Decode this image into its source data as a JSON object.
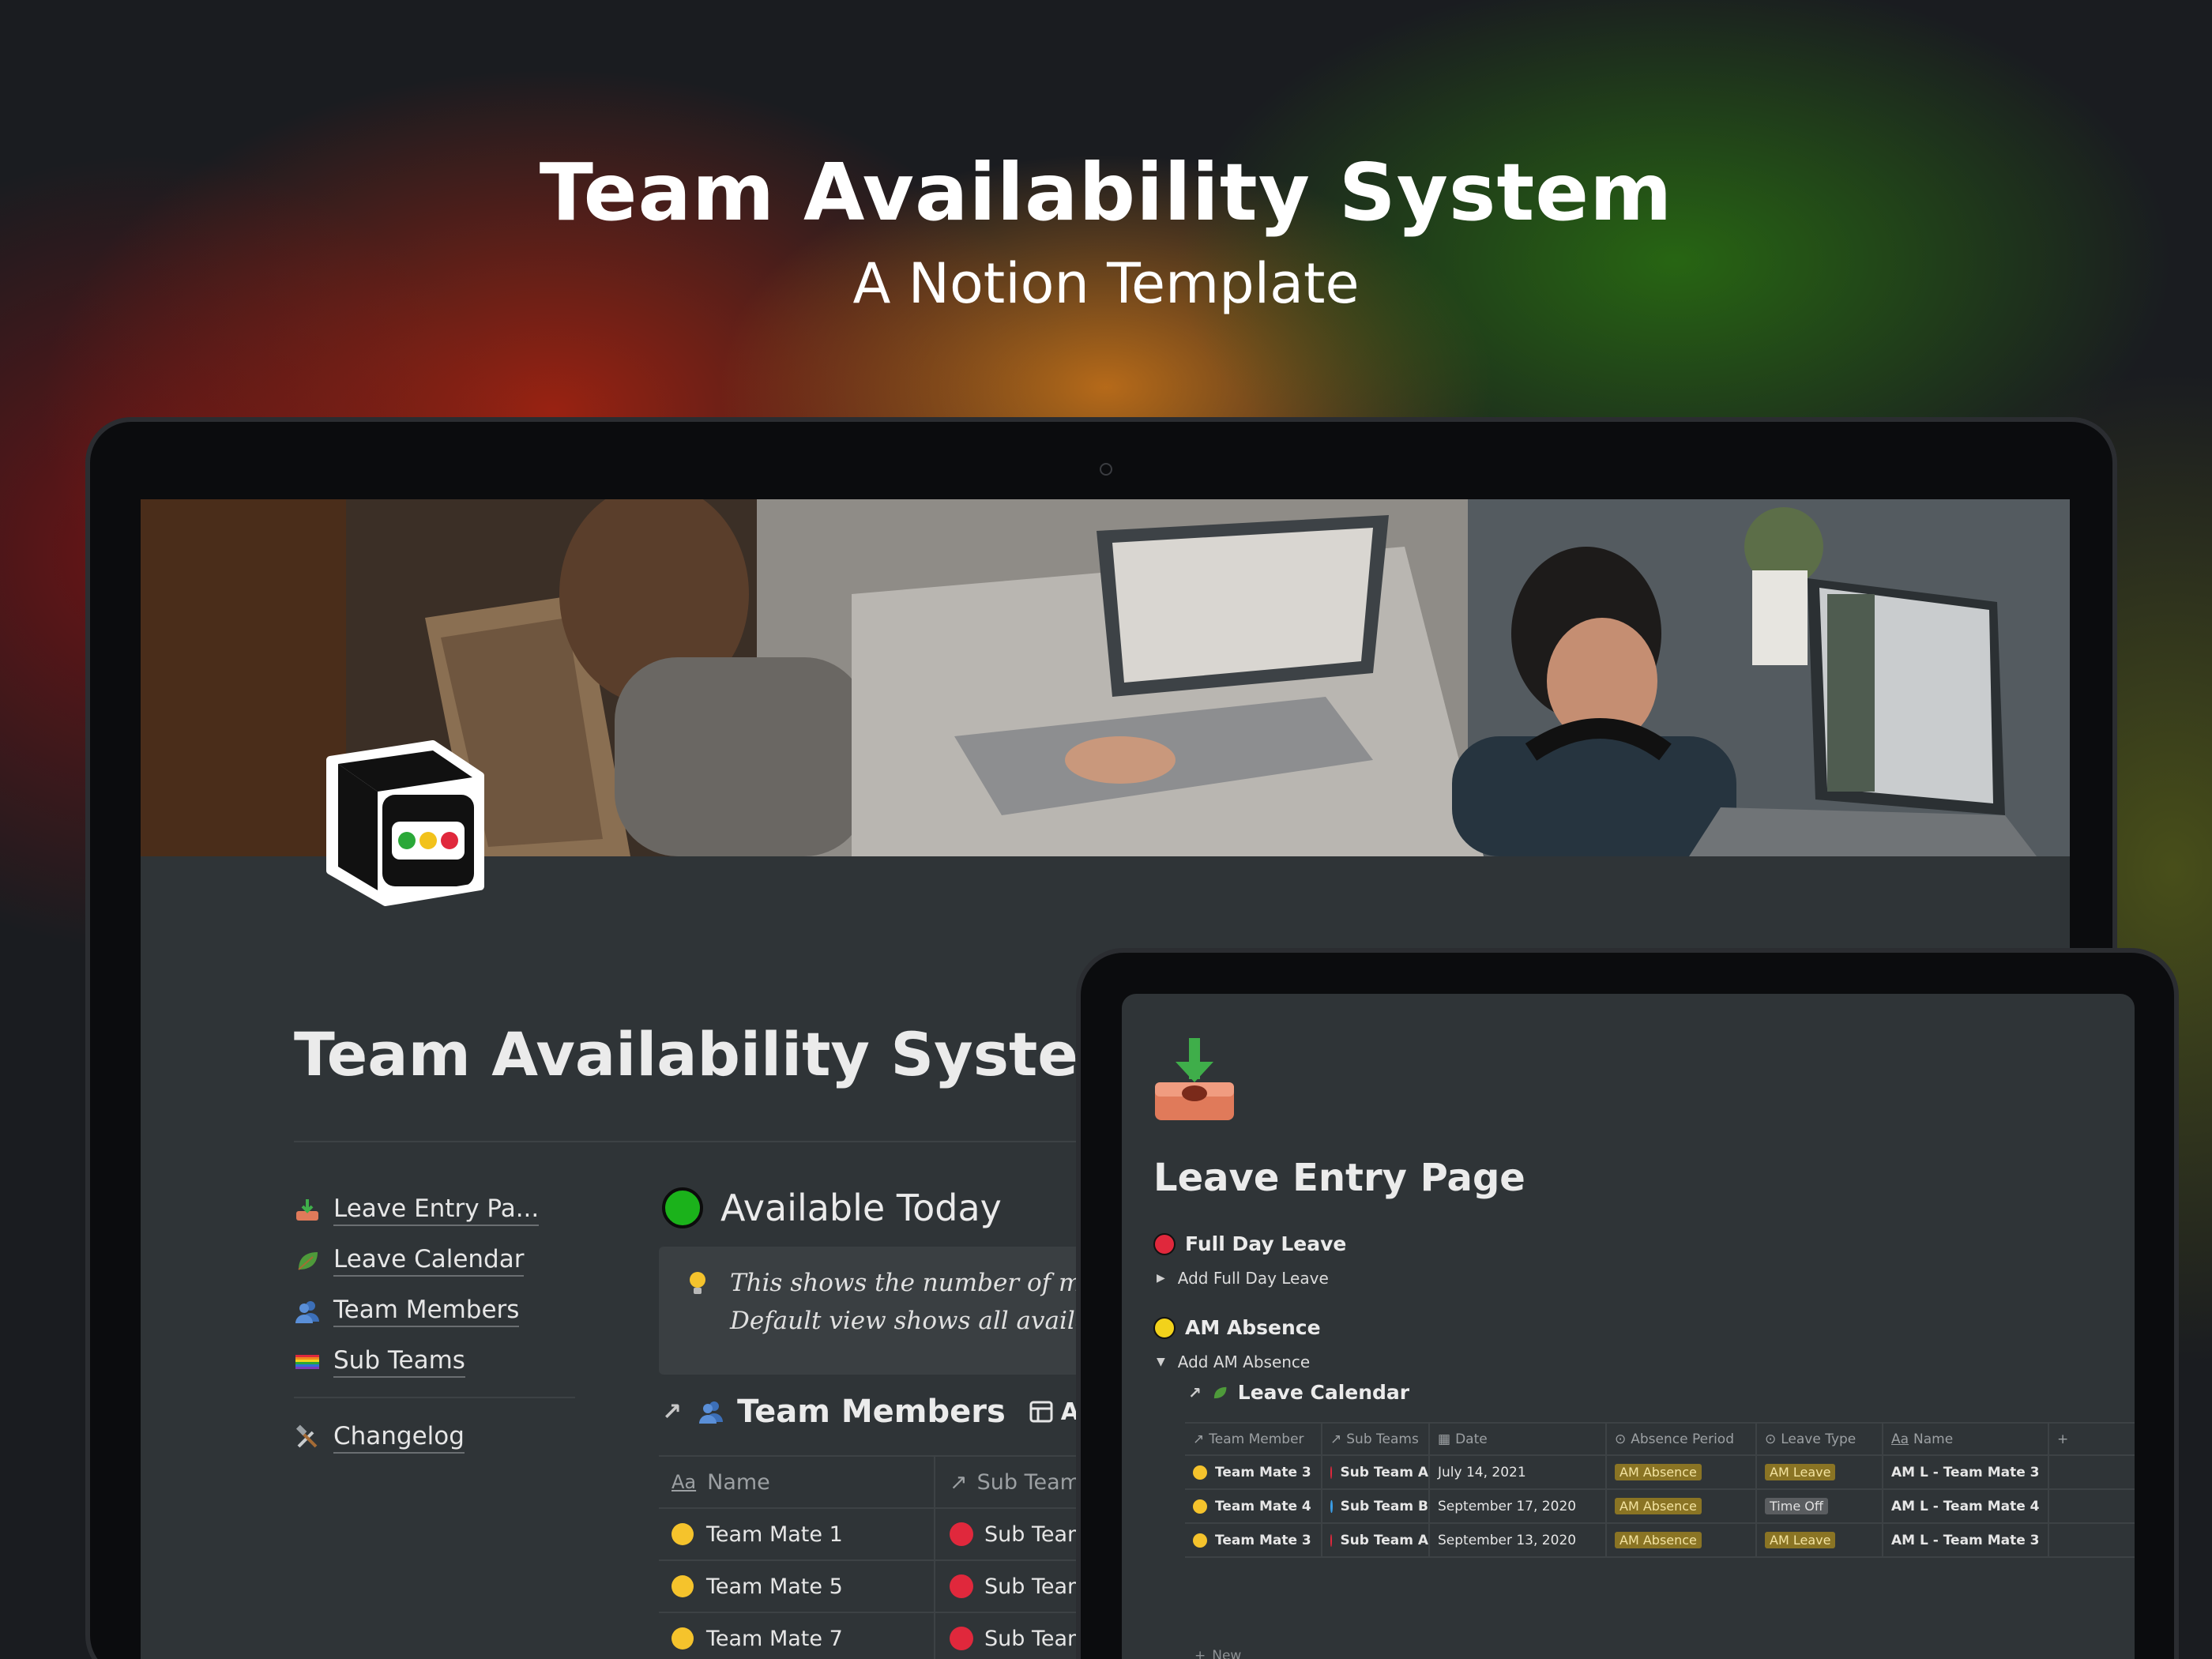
{
  "hero": {
    "title": "Team Availability System",
    "subtitle": "A Notion Template"
  },
  "laptop": {
    "page_title": "Team Availability System",
    "nav": [
      {
        "label": "Leave Entry Pa...",
        "icon": "inbox-tray-icon"
      },
      {
        "label": "Leave Calendar",
        "icon": "leaf-icon"
      },
      {
        "label": "Team Members",
        "icon": "busts-icon"
      },
      {
        "label": "Sub Teams",
        "icon": "rainbow-flag-icon"
      }
    ],
    "changelog": {
      "label": "Changelog",
      "icon": "hammer-wrench-icon"
    },
    "available_today": {
      "heading": "Available Today",
      "status_color": "#1bb21b"
    },
    "callout": {
      "line1": "This shows the number of memb",
      "line2": "Default view shows all available"
    },
    "team_members": {
      "heading": "Team Members",
      "view_label": "All Av",
      "columns": [
        "Name",
        "Sub Teams"
      ],
      "name_col_icon": "Aa",
      "rows": [
        {
          "name": "Team Mate 1",
          "sub_team": "Sub Team"
        },
        {
          "name": "Team Mate 5",
          "sub_team": "Sub Team"
        },
        {
          "name": "Team Mate 7",
          "sub_team": "Sub Team"
        }
      ]
    }
  },
  "tablet": {
    "page_title": "Leave Entry Page",
    "full_day": {
      "heading": "Full Day Leave",
      "toggle": "Add Full Day Leave",
      "color": "#e0283c"
    },
    "am_absence": {
      "heading": "AM Absence",
      "toggle": "Add AM Absence",
      "color": "#f2d21b"
    },
    "leave_calendar": {
      "heading": "Leave Calendar",
      "columns": [
        "Team Member",
        "Sub Teams",
        "Date",
        "Absence Period",
        "Leave Type",
        "Name",
        "+"
      ],
      "rows": [
        {
          "member": "Team Mate 3",
          "sub_team": "Sub Team A",
          "sub_color": "#e0283c",
          "date": "July 14, 2021",
          "period": "AM Absence",
          "type": "AM Leave",
          "name": "AM L - Team Mate 3"
        },
        {
          "member": "Team Mate 4",
          "sub_team": "Sub Team B",
          "sub_color": "#3a9ee8",
          "date": "September 17, 2020",
          "period": "AM Absence",
          "type": "Time Off",
          "name": "AM L - Team Mate 4"
        },
        {
          "member": "Team Mate 3",
          "sub_team": "Sub Team A",
          "sub_color": "#e0283c",
          "date": "September 13, 2020",
          "period": "AM Absence",
          "type": "AM Leave",
          "name": "AM L - Team Mate 3"
        }
      ],
      "new_label": "New"
    }
  }
}
